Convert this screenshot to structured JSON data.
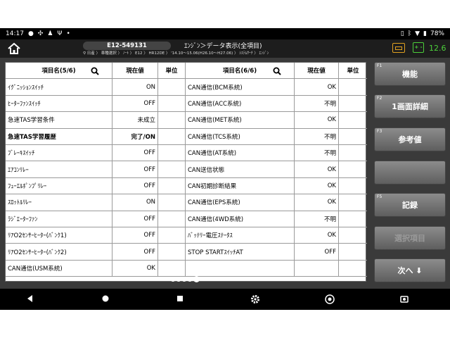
{
  "status": {
    "time": "14:17",
    "left_icons": [
      "chat-icon",
      "pinwheel-icon",
      "person-icon",
      "usb-icon"
    ],
    "battery": "78%"
  },
  "header": {
    "vin": "E12-549131",
    "title": "ｴﾝｼﾞﾝ＞データ表示(全項目)",
    "breadcrumb": "日産 〉 車種選択 〉 ﾉｰﾄ 〉 E12 〉 HR12DE 〉 '14.10～15.06(H26.10～H27.06) 〉 ｼｽﾃﾑｻｰﾁ 〉 ｴﾝｼﾞﾝ",
    "voltage": "12.6",
    "battery_icon_label": "+ -"
  },
  "table": {
    "headers": {
      "name_left": "項目名(5/6)",
      "value": "現在値",
      "unit": "単位",
      "name_right": "項目名(6/6)"
    },
    "rows": [
      {
        "l_name": "ｲｸﾞﾆｯｼｮﾝｽｲｯﾁ",
        "l_val": "ON",
        "l_unit": "",
        "r_name": "CAN通信(BCM系統)",
        "r_val": "OK",
        "r_unit": ""
      },
      {
        "l_name": "ﾋｰﾀｰﾌｧﾝｽｲｯﾁ",
        "l_val": "OFF",
        "l_unit": "",
        "r_name": "CAN通信(ACC系統)",
        "r_val": "不明",
        "r_unit": ""
      },
      {
        "l_name": "急速TAS学習条件",
        "l_val": "未成立",
        "l_unit": "",
        "r_name": "CAN通信(MET系統)",
        "r_val": "OK",
        "r_unit": ""
      },
      {
        "l_name": "急速TAS学習履歴",
        "l_val": "完了/ON",
        "l_unit": "",
        "r_name": "CAN通信(TCS系統)",
        "r_val": "不明",
        "r_unit": ""
      },
      {
        "l_name": "ﾌﾞﾚｰｷｽｲｯﾁ",
        "l_val": "OFF",
        "l_unit": "",
        "r_name": "CAN通信(AT系統)",
        "r_val": "不明",
        "r_unit": ""
      },
      {
        "l_name": "ｴｱｺﾝﾘﾚｰ",
        "l_val": "OFF",
        "l_unit": "",
        "r_name": "CAN送信状態",
        "r_val": "OK",
        "r_unit": ""
      },
      {
        "l_name": "ﾌｭｰｴﾙﾎﾟﾝﾌﾟﾘﾚｰ",
        "l_val": "OFF",
        "l_unit": "",
        "r_name": "CAN初期診断結果",
        "r_val": "OK",
        "r_unit": ""
      },
      {
        "l_name": "ｽﾛｯﾄﾙﾘﾚｰ",
        "l_val": "ON",
        "l_unit": "",
        "r_name": "CAN通信(EPS系統)",
        "r_val": "OK",
        "r_unit": ""
      },
      {
        "l_name": "ﾗｼﾞｴｰﾀｰﾌｧﾝ",
        "l_val": "OFF",
        "l_unit": "",
        "r_name": "CAN通信(4WD系統)",
        "r_val": "不明",
        "r_unit": ""
      },
      {
        "l_name": "ﾘｱO2ｾﾝｻｰﾋｰﾀｰ(ﾊﾞﾝｸ1)",
        "l_val": "OFF",
        "l_unit": "",
        "r_name": "ﾊﾞｯﾃﾘｰ電圧ｽﾃｰﾀｽ",
        "r_val": "OK",
        "r_unit": ""
      },
      {
        "l_name": "ﾘｱO2ｾﾝｻｰﾋｰﾀｰ(ﾊﾞﾝｸ2)",
        "l_val": "OFF",
        "l_unit": "",
        "r_name": "STOP STARTｽｲｯﾁAT",
        "r_val": "OFF",
        "r_unit": ""
      },
      {
        "l_name": "CAN通信(USM系統)",
        "l_val": "OK",
        "l_unit": "",
        "r_name": "",
        "r_val": "",
        "r_unit": ""
      }
    ],
    "highlighted_row": 3
  },
  "pager": {
    "count": 5,
    "active": 4
  },
  "fkeys": [
    {
      "tag": "F1",
      "label": "機能",
      "enabled": true
    },
    {
      "tag": "F2",
      "label": "1画面詳細",
      "enabled": true
    },
    {
      "tag": "F3",
      "label": "参考値",
      "enabled": true
    },
    {
      "tag": "",
      "label": "",
      "enabled": true
    },
    {
      "tag": "F5",
      "label": "記録",
      "enabled": true
    },
    {
      "tag": "",
      "label": "選択項目",
      "enabled": false
    },
    {
      "tag": "",
      "label": "次へ ⬇",
      "enabled": true
    }
  ],
  "nav": [
    "back-icon",
    "home-circle-icon",
    "recents-icon",
    "settings-icon",
    "chrome-icon",
    "screenshot-icon"
  ],
  "colors": {
    "accent_green": "#4ccf3a",
    "vci_orange": "#e0a020",
    "button_grey": "#7a7a7a"
  }
}
